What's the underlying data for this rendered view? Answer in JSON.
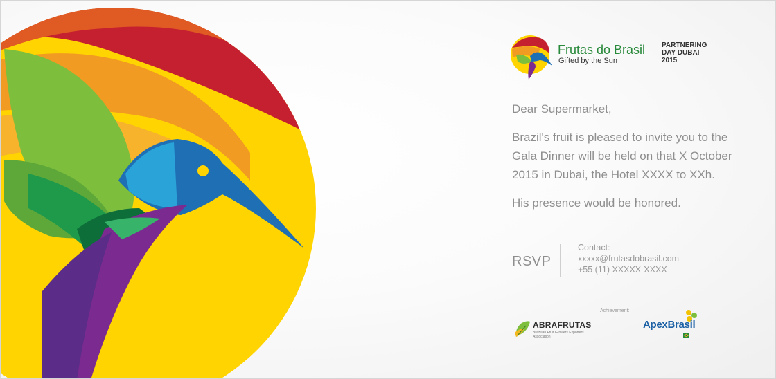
{
  "brand": {
    "name": "Frutas do Brasil",
    "tagline": "Gifted by the Sun",
    "event_line1": "PARTNERING",
    "event_line2": "DAY DUBAI",
    "event_line3": "2015"
  },
  "letter": {
    "salutation": "Dear Supermarket,",
    "body": "Brazil's fruit is pleased to invite you to the Gala Dinner will be held on that X October 2015 in Dubai, the Hotel XXXX to XXh.",
    "closing": "His presence would be honored."
  },
  "rsvp": {
    "label": "RSVP",
    "contact_label": "Contact:",
    "email": "xxxxx@frutasdobrasil.com",
    "phone": "+55 (11) XXXXX-XXXX"
  },
  "sponsors": {
    "achievement_label": "Achievement:",
    "abrafrutas": "ABRAFRUTAS",
    "abrafrutas_sub": "Brazilian Fruit Growers Exporters Association",
    "apex": "ApexBrasil"
  },
  "colors": {
    "green": "#2a8a3c",
    "text_gray": "#8e8e8e",
    "red": "#c4202f",
    "orange": "#f29b22",
    "yellow": "#ffd400",
    "blue": "#1f6fb4",
    "purple": "#7b2a90"
  }
}
